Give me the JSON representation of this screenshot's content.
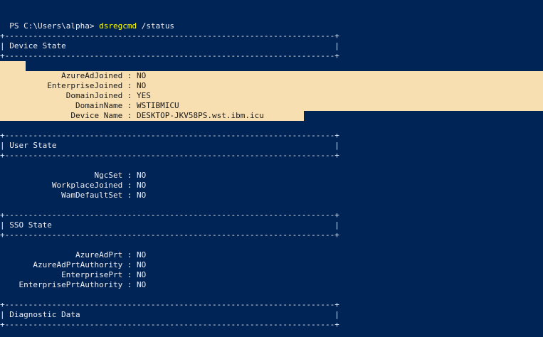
{
  "window": {
    "title_fragment": ""
  },
  "prompt": {
    "text": "PS C:\\Users\\alpha> ",
    "command": "dsregcmd",
    "args": " /status"
  },
  "border": "+----------------------------------------------------------------------+",
  "sections": {
    "device_state": {
      "title": "| Device State                                                         |",
      "rows": [
        "             AzureAdJoined : NO",
        "          EnterpriseJoined : NO",
        "              DomainJoined : YES",
        "                DomainName : WSTIBMICU",
        "               Device Name : DESKTOP-JKV58PS.wst.ibm.icu"
      ]
    },
    "user_state": {
      "title": "| User State                                                           |",
      "rows": [
        "                    NgcSet : NO",
        "           WorkplaceJoined : NO",
        "             WamDefaultSet : NO"
      ]
    },
    "sso_state": {
      "title": "| SSO State                                                            |",
      "rows": [
        "                AzureAdPrt : NO",
        "       AzureAdPrtAuthority : NO",
        "             EnterprisePrt : NO",
        "    EnterprisePrtAuthority : NO"
      ]
    },
    "diagnostic_data": {
      "title": "| Diagnostic Data                                                      |"
    }
  },
  "colors": {
    "background": "#012456",
    "text": "#eeedf0",
    "command": "#ffff00",
    "selection": "#f8dfb2"
  }
}
